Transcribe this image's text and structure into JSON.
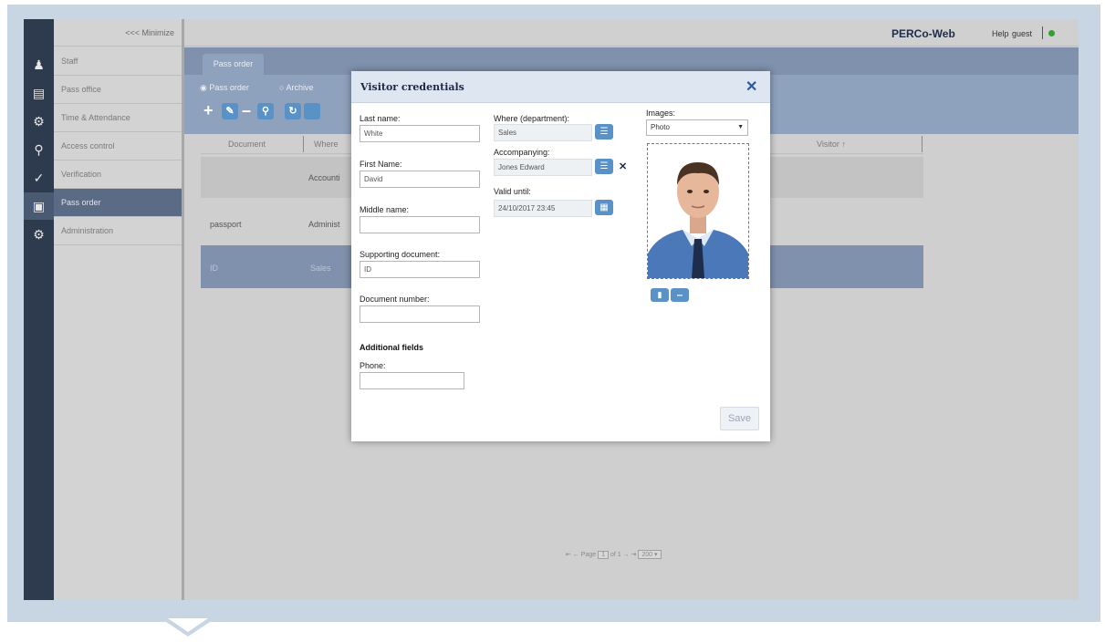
{
  "sidebar": {
    "minimize": "<<< Minimize",
    "items": [
      {
        "label": "Staff",
        "icon": "staff-icon"
      },
      {
        "label": "Pass office",
        "icon": "pass-office-icon"
      },
      {
        "label": "Time & Attendance",
        "icon": "time-attendance-icon"
      },
      {
        "label": "Access control",
        "icon": "key-icon"
      },
      {
        "label": "Verification",
        "icon": "verification-icon"
      },
      {
        "label": "Pass order",
        "icon": "pass-order-icon"
      },
      {
        "label": "Administration",
        "icon": "gear-icon"
      }
    ],
    "active": "Pass order"
  },
  "header": {
    "brand": "PERCo-Web",
    "help": "Help",
    "user": "guest",
    "status_color": "#2fa12f"
  },
  "tabs": [
    {
      "label": "Pass order"
    }
  ],
  "filters": {
    "pass_order": "Pass order",
    "archive": "Archive"
  },
  "grid": {
    "columns": {
      "document": "Document",
      "where": "Where",
      "visitor": "Visitor"
    },
    "sort_marker": "↑",
    "rows": [
      {
        "where": "Accounti"
      },
      {
        "document": "passport",
        "where": "Administ"
      },
      {
        "document": "ID",
        "where": "Sales"
      }
    ]
  },
  "pager": {
    "page_label": "Page",
    "page": "1",
    "of": "of 1",
    "page_size": "200"
  },
  "modal": {
    "title": "Visitor credentials",
    "last_name": {
      "label": "Last name:",
      "value": "White"
    },
    "first_name": {
      "label": "First Name:",
      "value": "David"
    },
    "middle_name": {
      "label": "Middle name:",
      "value": ""
    },
    "supporting_document": {
      "label": "Supporting document:",
      "value": "ID"
    },
    "document_number": {
      "label": "Document number:",
      "value": ""
    },
    "additional_fields": "Additional fields",
    "phone": {
      "label": "Phone:",
      "value": ""
    },
    "department": {
      "label": "Where (department):",
      "value": "Sales"
    },
    "accompanying": {
      "label": "Accompanying:",
      "value": "Jones Edward"
    },
    "valid_until": {
      "label": "Valid until:",
      "value": "24/10/2017 23:45"
    },
    "images": {
      "label": "Images:",
      "selected": "Photo"
    },
    "save": "Save"
  }
}
